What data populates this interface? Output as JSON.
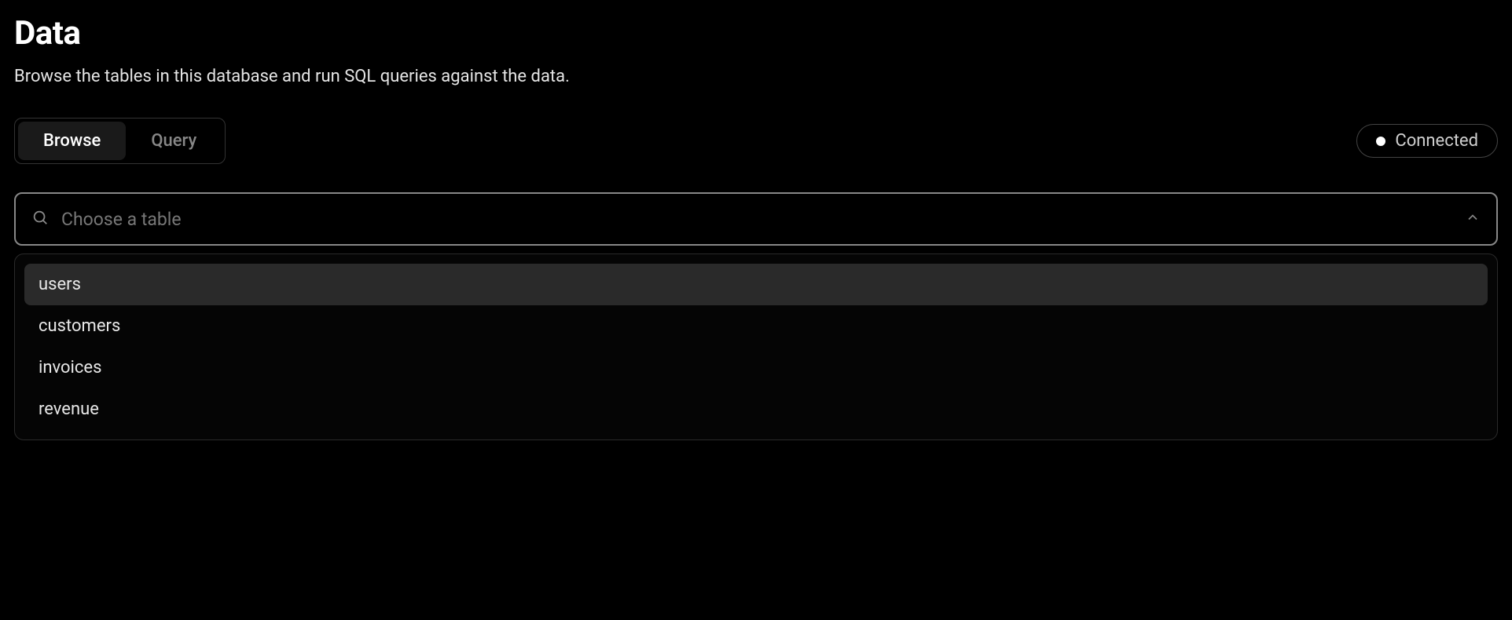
{
  "header": {
    "title": "Data",
    "description": "Browse the tables in this database and run SQL queries against the data."
  },
  "tabs": {
    "browse": "Browse",
    "query": "Query"
  },
  "status": {
    "label": "Connected"
  },
  "table_select": {
    "placeholder": "Choose a table",
    "options": [
      "users",
      "customers",
      "invoices",
      "revenue"
    ]
  }
}
